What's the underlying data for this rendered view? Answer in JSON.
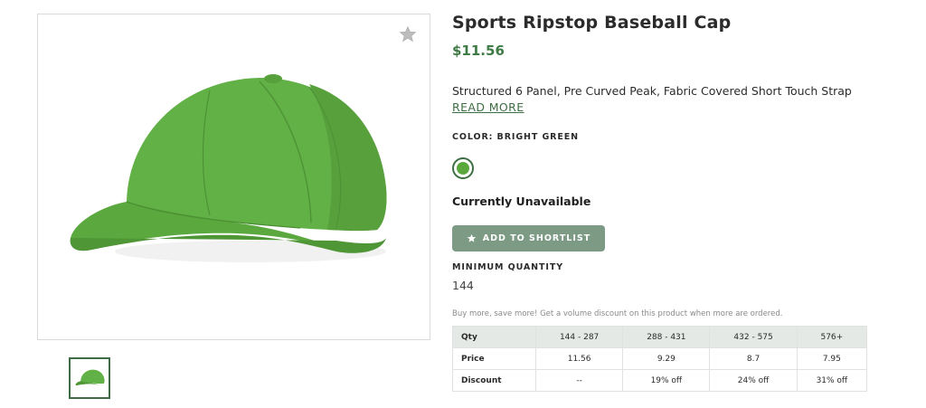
{
  "product": {
    "title": "Sports Ripstop Baseball Cap",
    "price": "$11.56",
    "description": "Structured 6 Panel, Pre Curved Peak, Fabric Covered Short Touch Strap",
    "read_more": "READ MORE",
    "color_label": "COLOR: BRIGHT GREEN",
    "color_hex": "#5aa83d",
    "availability": "Currently Unavailable",
    "shortlist_button": "ADD TO SHORTLIST",
    "min_qty_label": "MINIMUM QUANTITY",
    "min_qty_value": "144",
    "volume_note": "Buy more, save more! Get a volume discount on this product when more are ordered."
  },
  "icons": {
    "favorite": "star-icon",
    "shortlist": "star-icon"
  },
  "pricing_table": {
    "headers": [
      "Qty",
      "144 - 287",
      "288 - 431",
      "432 - 575",
      "576+"
    ],
    "rows": [
      [
        "Price",
        "11.56",
        "9.29",
        "8.7",
        "7.95"
      ],
      [
        "Discount",
        "--",
        "19% off",
        "24% off",
        "31% off"
      ]
    ]
  },
  "colors": {
    "accent": "#3e7a44",
    "button": "#7c9a84",
    "table_header": "#e4e9e5"
  }
}
